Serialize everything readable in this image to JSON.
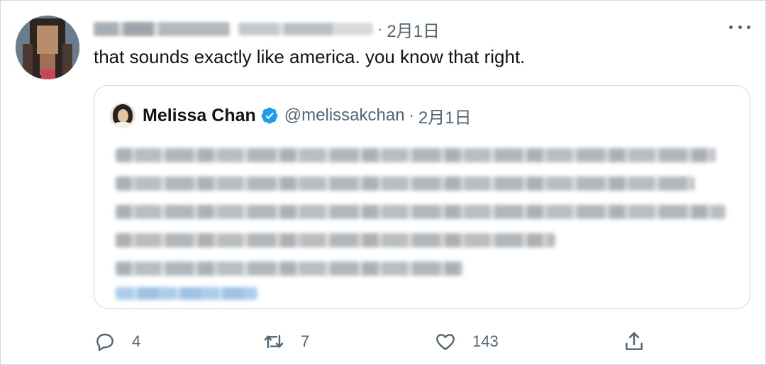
{
  "tweet": {
    "timestamp": "2月1日",
    "separator": "·",
    "text": "that sounds exactly like america. you know that right."
  },
  "quoted_tweet": {
    "author_name": "Melissa Chan",
    "handle": "@melissakchan",
    "separator": "·",
    "timestamp": "2月1日"
  },
  "actions": {
    "reply_count": "4",
    "retweet_count": "7",
    "like_count": "143"
  },
  "colors": {
    "text_primary": "#0f1419",
    "text_secondary": "#536471",
    "border": "#cfd9de",
    "verified": "#1d9bf0"
  },
  "icons": {
    "more": "more-horizontal-icon",
    "verified": "verified-badge-icon",
    "reply": "reply-icon",
    "retweet": "retweet-icon",
    "like": "heart-icon",
    "share": "share-icon"
  }
}
